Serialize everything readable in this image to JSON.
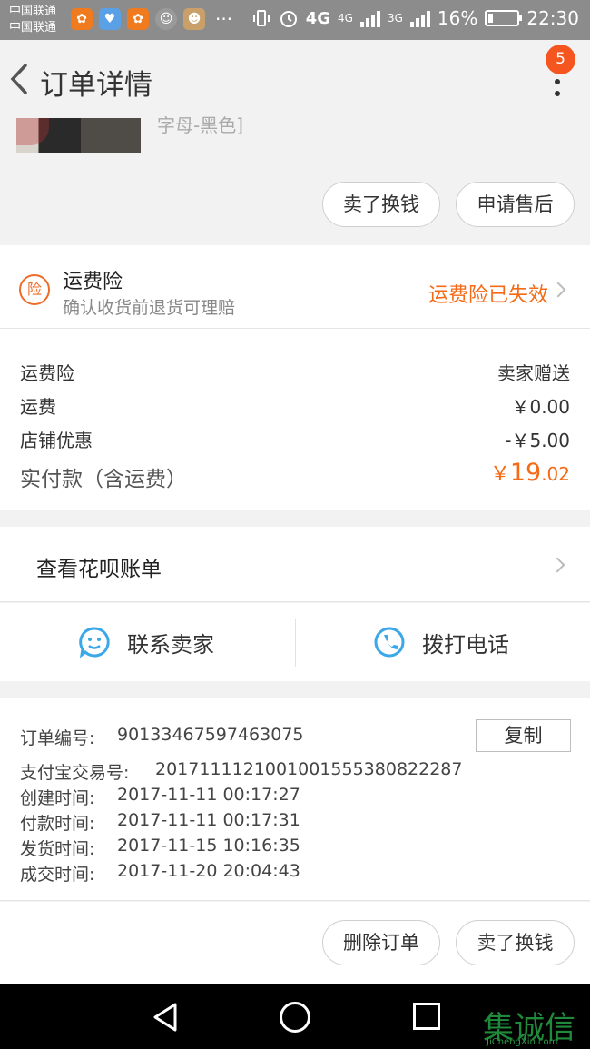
{
  "status_bar": {
    "carrier_1": "中国联通",
    "carrier_2": "中国联通",
    "network_1": "4G",
    "network_2": "4G",
    "network_3": "3G",
    "battery": "16%",
    "time": "22:30",
    "overflow": "···"
  },
  "header": {
    "title": "订单详情",
    "badge_count": "5"
  },
  "product": {
    "sku_text": "字母-黑色]",
    "sell_button": "卖了换钱",
    "after_sale_button": "申请售后"
  },
  "insurance": {
    "icon_text": "险",
    "title": "运费险",
    "subtitle": "确认收货前退货可理赔",
    "status": "运费险已失效"
  },
  "fees": [
    {
      "label": "运费险",
      "value": "卖家赠送"
    },
    {
      "label": "运费",
      "value": "￥0.00"
    },
    {
      "label": "店铺优惠",
      "value": "-￥5.00"
    }
  ],
  "total": {
    "label": "实付款（含运费）",
    "currency": "￥",
    "integer": "19",
    "decimal": ".02"
  },
  "huabei": {
    "label": "查看花呗账单"
  },
  "contact": {
    "seller_label": "联系卖家",
    "phone_label": "拨打电话"
  },
  "order_info": {
    "copy_button": "复制",
    "rows": [
      {
        "label": "订单编号:",
        "value": "90133467597463075"
      },
      {
        "label": "支付宝交易号:",
        "value": "2017111121001001555380822287"
      },
      {
        "label": "创建时间:",
        "value": "2017-11-11 00:17:27"
      },
      {
        "label": "付款时间:",
        "value": "2017-11-11 00:17:31"
      },
      {
        "label": "发货时间:",
        "value": "2017-11-15 10:16:35"
      },
      {
        "label": "成交时间:",
        "value": "2017-11-20 20:04:43"
      }
    ]
  },
  "actions": {
    "delete_button": "删除订单",
    "sell_button": "卖了换钱"
  },
  "watermark": {
    "cn": "集诚信",
    "en": "JiChengXin.com"
  },
  "colors": {
    "accent_orange": "#f56a17",
    "badge_red": "#f5561f",
    "icon_blue": "#3aa8e8"
  }
}
